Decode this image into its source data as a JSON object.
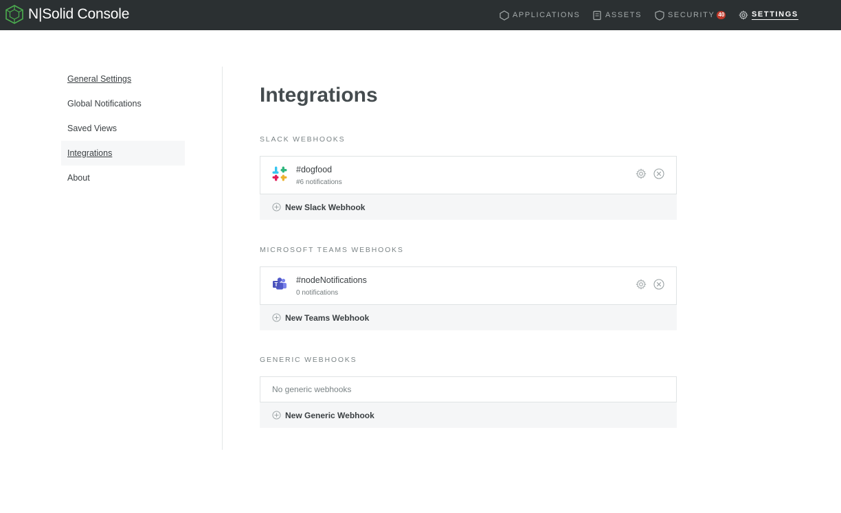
{
  "app": {
    "title": "N|Solid Console"
  },
  "nav": {
    "items": [
      {
        "label": "APPLICATIONS",
        "icon": "applications-icon",
        "active": false
      },
      {
        "label": "ASSETS",
        "icon": "assets-icon",
        "active": false
      },
      {
        "label": "SECURITY",
        "icon": "shield-icon",
        "active": false,
        "badge": "40"
      },
      {
        "label": "SETTINGS",
        "icon": "gear-icon",
        "active": true
      }
    ]
  },
  "sidebar": {
    "items": [
      {
        "label": "General Settings"
      },
      {
        "label": "Global Notifications"
      },
      {
        "label": "Saved Views"
      },
      {
        "label": "Integrations",
        "selected": true
      },
      {
        "label": "About"
      }
    ]
  },
  "main": {
    "title": "Integrations",
    "sections": [
      {
        "heading": "SLACK WEBHOOKS",
        "webhooks": [
          {
            "name": "#dogfood",
            "detail": "#6 notifications",
            "icon": "slack-icon"
          }
        ],
        "add_label": "New Slack Webhook"
      },
      {
        "heading": "MICROSOFT TEAMS WEBHOOKS",
        "webhooks": [
          {
            "name": "#nodeNotifications",
            "detail": "0 notifications",
            "icon": "teams-icon"
          }
        ],
        "add_label": "New Teams Webhook"
      },
      {
        "heading": "GENERIC WEBHOOKS",
        "empty_text": "No generic webhooks",
        "add_label": "New Generic Webhook"
      }
    ]
  },
  "colors": {
    "topbar": "#2b3032",
    "brand_green": "#4cae4f",
    "badge": "#c0392b",
    "selected_bg": "#f6f7f8",
    "add_row_bg": "#f5f6f7"
  }
}
